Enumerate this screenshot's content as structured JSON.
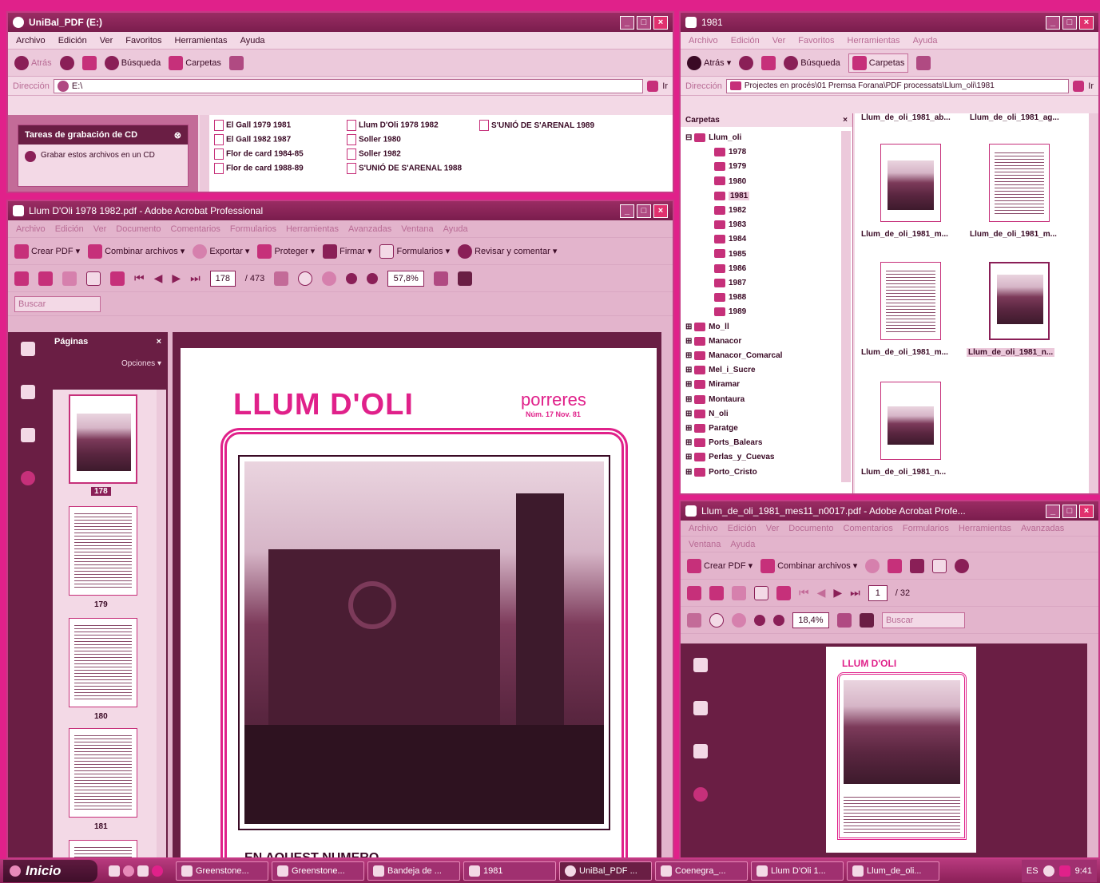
{
  "explorer1": {
    "title": "UniBal_PDF (E:)",
    "menu": [
      "Archivo",
      "Edición",
      "Ver",
      "Favoritos",
      "Herramientas",
      "Ayuda"
    ],
    "toolbar": {
      "back": "Atrás",
      "search": "Búsqueda",
      "folders": "Carpetas"
    },
    "address_label": "Dirección",
    "address": "E:\\",
    "go": "Ir",
    "task_panel": {
      "title": "Tareas de grabación de CD",
      "item": "Grabar estos archivos en un CD"
    },
    "files": [
      "El Gall 1979 1981",
      "El Gall 1982 1987",
      "Flor de card 1984-85",
      "Flor de card 1988-89",
      "Llum D'Oli 1978 1982",
      "Soller 1980",
      "Soller 1982",
      "S'UNIÓ DE S'ARENAL 1988",
      "S'UNIÓ DE S'ARENAL 1989"
    ]
  },
  "acrobat1": {
    "title": "Llum D'Oli 1978 1982.pdf - Adobe Acrobat Professional",
    "menu": [
      "Archivo",
      "Edición",
      "Ver",
      "Documento",
      "Comentarios",
      "Formularios",
      "Herramientas",
      "Avanzadas",
      "Ventana",
      "Ayuda"
    ],
    "tasks": [
      "Crear PDF",
      "Combinar archivos",
      "Exportar",
      "Proteger",
      "Firmar",
      "Formularios",
      "Revisar y comentar"
    ],
    "page_current": "178",
    "page_total": "/ 473",
    "zoom": "57,8%",
    "search_placeholder": "Buscar",
    "pages_panel": {
      "title": "Páginas",
      "options": "Opciones"
    },
    "thumb_labels": [
      "178",
      "179",
      "180",
      "181"
    ],
    "doc": {
      "masthead": "LLUM D'OLI",
      "town": "porreres",
      "issue": "Núm. 17  Nov. 81",
      "bottom_text": "EN AQUEST NUMERO"
    }
  },
  "explorer2": {
    "title": "1981",
    "menu": [
      "Archivo",
      "Edición",
      "Ver",
      "Favoritos",
      "Herramientas",
      "Ayuda"
    ],
    "toolbar": {
      "back": "Atrás",
      "search": "Búsqueda",
      "folders": "Carpetas"
    },
    "address_label": "Dirección",
    "address": "Projectes en procés\\01 Premsa Forana\\PDF processats\\Llum_oli\\1981",
    "go": "Ir",
    "folders_header": "Carpetas",
    "tree_root": "Llum_oli",
    "years": [
      "1978",
      "1979",
      "1980",
      "1981",
      "1982",
      "1983",
      "1984",
      "1985",
      "1986",
      "1987",
      "1988",
      "1989"
    ],
    "others": [
      "Mo_ll",
      "Manacor",
      "Manacor_Comarcal",
      "Mel_i_Sucre",
      "Miramar",
      "Montaura",
      "N_oli",
      "Paratge",
      "Ports_Balears",
      "Perlas_y_Cuevas",
      "Porto_Cristo"
    ],
    "top_files": [
      "Llum_de_oli_1981_ab...",
      "Llum_de_oli_1981_ag..."
    ],
    "files": [
      "Llum_de_oli_1981_m...",
      "Llum_de_oli_1981_m...",
      "Llum_de_oli_1981_m...",
      "Llum_de_oli_1981_n...",
      "Llum_de_oli_1981_n..."
    ]
  },
  "acrobat2": {
    "title": "Llum_de_oli_1981_mes11_n0017.pdf - Adobe Acrobat Profe...",
    "menu1": [
      "Archivo",
      "Edición",
      "Ver",
      "Documento",
      "Comentarios",
      "Formularios",
      "Herramientas",
      "Avanzadas"
    ],
    "menu2": [
      "Ventana",
      "Ayuda"
    ],
    "tasks": [
      "Crear PDF",
      "Combinar archivos"
    ],
    "page_current": "1",
    "page_total": "/ 32",
    "zoom": "18,4%",
    "search_placeholder": "Buscar",
    "doc_masthead": "LLUM D'OLI"
  },
  "taskbar": {
    "start": "Inicio",
    "tasks": [
      "Greenstone...",
      "Greenstone...",
      "Bandeja de ...",
      "1981",
      "UniBal_PDF ...",
      "Coenegra_...",
      "Llum D'Oli 1...",
      "Llum_de_oli..."
    ],
    "lang": "ES",
    "clock": "9:41"
  },
  "colors": {
    "accent": "#e0218a",
    "title": "#8a1f57",
    "panel": "#f3d9e6",
    "dark": "#6a1e44"
  }
}
